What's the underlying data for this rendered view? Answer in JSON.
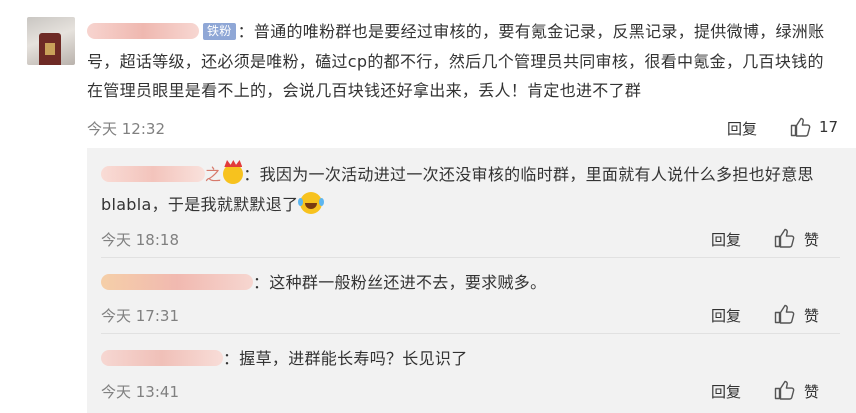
{
  "main_comment": {
    "badge": "铁粉",
    "text": "：普通的唯粉群也是要经过审核的，要有氪金记录，反黑记录，提供微博，绿洲账号，超话等级，还必须是唯粉，磕过cp的都不行，然后几个管理员共同审核，很看中氪金，几百块钱的在管理员眼里是看不上的，会说几百块钱还好拿出来，丢人！肯定也进不了群",
    "time": "今天 12:32",
    "reply_label": "回复",
    "likes": "17"
  },
  "replies": [
    {
      "name_tail": "之",
      "text": "：我因为一次活动进过一次还没审核的临时群，里面就有人说什么多担也好意思blabla，于是我就默默退了",
      "time": "今天 18:18",
      "reply_label": "回复",
      "like_label": "赞"
    },
    {
      "text": "：这种群一般粉丝还进不去，要求贼多。",
      "time": "今天 17:31",
      "reply_label": "回复",
      "like_label": "赞"
    },
    {
      "text": "：握草，进群能长寿吗？长见识了",
      "time": "今天 13:41",
      "reply_label": "回复",
      "like_label": "赞"
    }
  ],
  "colors": {
    "username_blur": "#f4c7c0",
    "badge_bg": "#8fa7d6",
    "meta_gray": "#808080",
    "panel_bg": "#f2f2f2"
  }
}
